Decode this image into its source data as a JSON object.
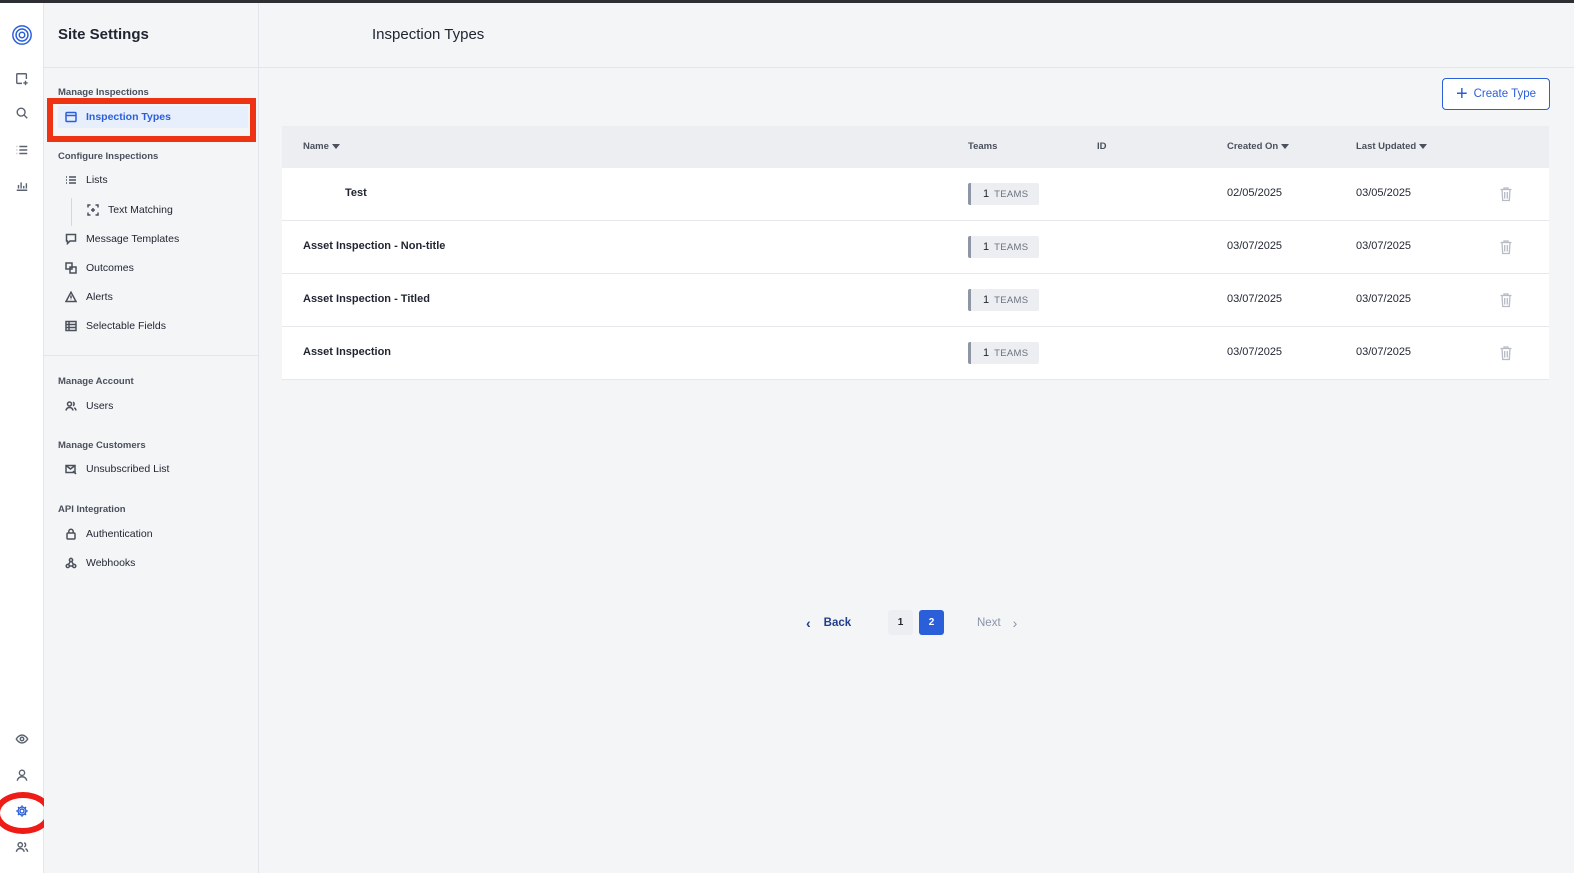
{
  "sidebar_title": "Site Settings",
  "page_title": "Inspection Types",
  "create_button": "Create Type",
  "nav": {
    "manage_inspections": "Manage Inspections",
    "inspection_types": "Inspection Types",
    "configure_inspections": "Configure Inspections",
    "lists": "Lists",
    "text_matching": "Text Matching",
    "message_templates": "Message Templates",
    "outcomes": "Outcomes",
    "alerts": "Alerts",
    "selectable_fields": "Selectable Fields",
    "manage_account": "Manage Account",
    "users": "Users",
    "manage_customers": "Manage Customers",
    "unsubscribed_list": "Unsubscribed List",
    "api_integration": "API Integration",
    "authentication": "Authentication",
    "webhooks": "Webhooks"
  },
  "columns": {
    "name": "Name",
    "teams": "Teams",
    "id": "ID",
    "created_on": "Created On",
    "last_updated": "Last Updated"
  },
  "rows": [
    {
      "name": "Test",
      "teams_count": "1",
      "teams_label": "TEAMS",
      "created": "02/05/2025",
      "updated": "03/05/2025"
    },
    {
      "name": "Asset Inspection - Non-title",
      "teams_count": "1",
      "teams_label": "TEAMS",
      "created": "03/07/2025",
      "updated": "03/07/2025"
    },
    {
      "name": "Asset Inspection - Titled",
      "teams_count": "1",
      "teams_label": "TEAMS",
      "created": "03/07/2025",
      "updated": "03/07/2025"
    },
    {
      "name": "Asset Inspection",
      "teams_count": "1",
      "teams_label": "TEAMS",
      "created": "03/07/2025",
      "updated": "03/07/2025"
    }
  ],
  "pagination": {
    "back": "Back",
    "page1": "1",
    "page2": "2",
    "next": "Next",
    "current_page": 2
  },
  "colors": {
    "accent": "#2b5fd9",
    "highlight": "#ee3315"
  }
}
